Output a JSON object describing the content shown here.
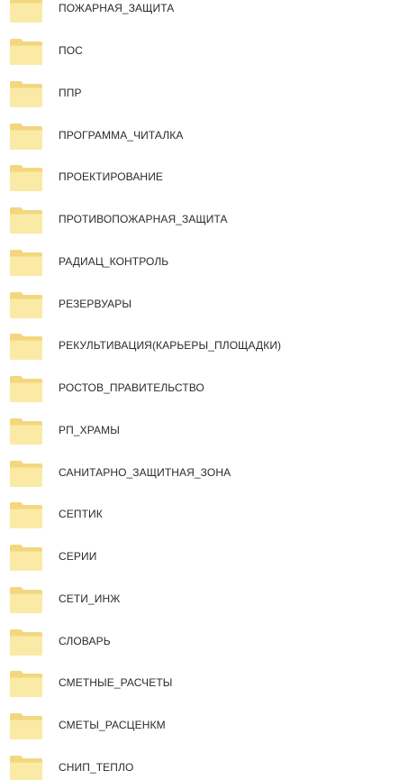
{
  "colors": {
    "folder_body": "#FBEAA6",
    "folder_back": "#F2D77F",
    "text": "#2B2B2B",
    "background": "#FFFFFF"
  },
  "folder_icon_name": "folder-icon",
  "folders": [
    {
      "label": "ПОЖАРНАЯ_ЗАЩИТА"
    },
    {
      "label": "ПОС"
    },
    {
      "label": "ППР"
    },
    {
      "label": "ПРОГРАММА_ЧИТАЛКА"
    },
    {
      "label": "ПРОЕКТИРОВАНИЕ"
    },
    {
      "label": "ПРОТИВОПОЖАРНАЯ_ЗАЩИТА"
    },
    {
      "label": "РАДИАЦ_КОНТРОЛЬ"
    },
    {
      "label": "РЕЗЕРВУАРЫ"
    },
    {
      "label": "РЕКУЛЬТИВАЦИЯ(КАРЬЕРЫ_ПЛОЩАДКИ)"
    },
    {
      "label": "РОСТОВ_ПРАВИТЕЛЬСТВО"
    },
    {
      "label": "РП_ХРАМЫ"
    },
    {
      "label": "САНИТАРНО_ЗАЩИТНАЯ_ЗОНА"
    },
    {
      "label": "СЕПТИК"
    },
    {
      "label": "СЕРИИ"
    },
    {
      "label": "СЕТИ_ИНЖ"
    },
    {
      "label": "СЛОВАРЬ"
    },
    {
      "label": "СМЕТНЫЕ_РАСЧЕТЫ"
    },
    {
      "label": "СМЕТЫ_РАСЦЕНКМ"
    },
    {
      "label": "СНИП_ТЕПЛО"
    }
  ]
}
